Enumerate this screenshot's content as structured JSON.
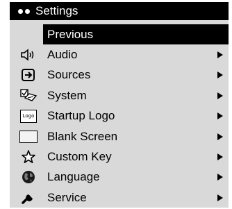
{
  "window": {
    "title": "Settings"
  },
  "menu": {
    "selected_label": "Previous",
    "items": [
      {
        "label": "Audio",
        "icon": "speaker-icon"
      },
      {
        "label": "Sources",
        "icon": "sources-input-icon"
      },
      {
        "label": "System",
        "icon": "system-checklist-icon"
      },
      {
        "label": "Startup Logo",
        "icon": "logo-icon",
        "icon_text": "Logo"
      },
      {
        "label": "Blank Screen",
        "icon": "blank-screen-icon"
      },
      {
        "label": "Custom Key",
        "icon": "star-icon"
      },
      {
        "label": "Language",
        "icon": "globe-icon"
      },
      {
        "label": "Service",
        "icon": "wrench-icon"
      }
    ]
  },
  "colors": {
    "background": "#d9d9d9",
    "highlight": "#000000",
    "highlight_text": "#ffffff"
  }
}
